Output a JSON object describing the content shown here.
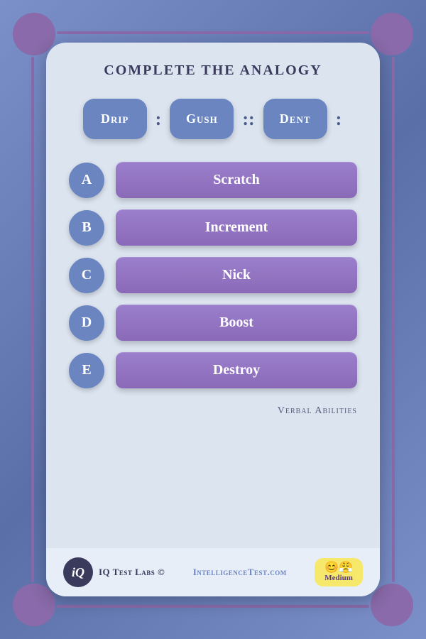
{
  "background": {
    "outer_color": "#6a7fbd"
  },
  "card": {
    "title": "Complete the Analogy",
    "analogy": {
      "word1": "Drip",
      "sep1": ":",
      "word2": "Gush",
      "sep2": "::",
      "word3": "Dent",
      "sep3": ":"
    },
    "options": [
      {
        "letter": "A",
        "text": "Scratch"
      },
      {
        "letter": "B",
        "text": "Increment"
      },
      {
        "letter": "C",
        "text": "Nick"
      },
      {
        "letter": "D",
        "text": "Boost"
      },
      {
        "letter": "E",
        "text": "Destroy"
      }
    ],
    "category": "Verbal Abilities"
  },
  "footer": {
    "logo_text": "iQ",
    "brand": "IQ Test Labs ©",
    "site": "IntelligenceTest.com",
    "difficulty_faces": "😊😤",
    "difficulty": "Medium"
  }
}
